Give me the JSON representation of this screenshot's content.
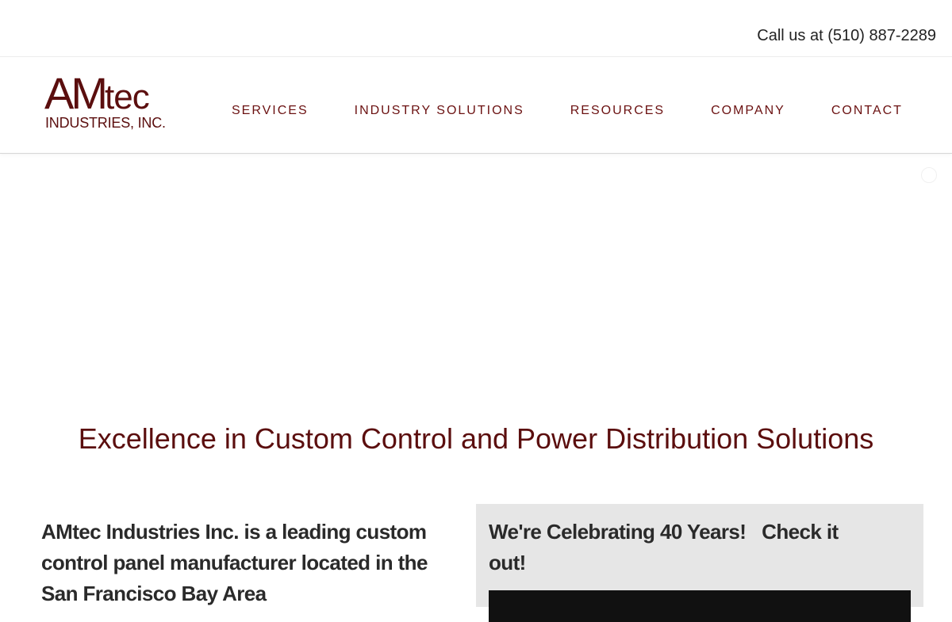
{
  "topbar": {
    "phone_text": "Call us at (510) 887-2289"
  },
  "logo": {
    "brand_big": "AM",
    "brand_small": "tec",
    "subtitle": "INDUSTRIES, INC.",
    "color": "#5b0e0e"
  },
  "nav": {
    "items": [
      {
        "label": "SERVICES"
      },
      {
        "label": "INDUSTRY SOLUTIONS"
      },
      {
        "label": "RESOURCES"
      },
      {
        "label": "COMPANY"
      },
      {
        "label": "CONTACT"
      }
    ],
    "color": "#6b1111"
  },
  "hero": {
    "tagline": "Excellence in Custom Control and Power Distribution Solutions"
  },
  "intro": {
    "text": "AMtec Industries Inc. is a leading custom control panel manufacturer located in the San Francisco Bay Area"
  },
  "promo": {
    "title": "We're Celebrating 40 Years!   Check it out!"
  }
}
